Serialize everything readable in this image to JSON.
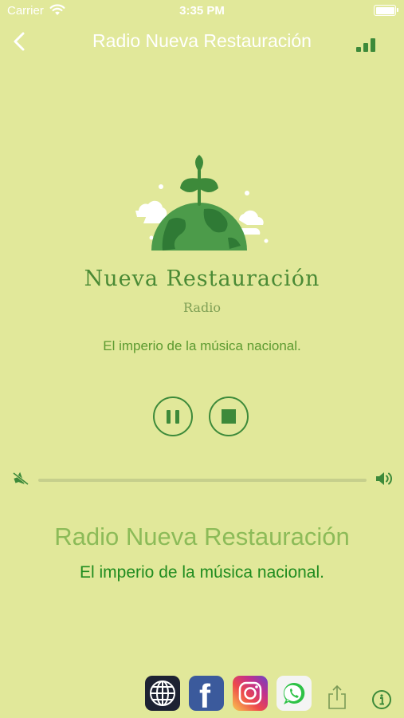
{
  "status_bar": {
    "carrier": "Carrier",
    "time": "3:35 PM"
  },
  "nav": {
    "title": "Radio Nueva Restauración"
  },
  "logo": {
    "name": "Nueva Restauración",
    "subtitle": "Radio"
  },
  "station": {
    "slogan": "El imperio de la música nacional."
  },
  "volume": {
    "level": 0.0
  },
  "now_playing": {
    "station": "Radio Nueva Restauración",
    "slogan": "El imperio de la música nacional."
  },
  "colors": {
    "background": "#e1e89a",
    "accent_green": "#3d8a3a",
    "slogan_green": "#1f8c1f",
    "station_green": "#8cbb58"
  },
  "icons": {
    "back": "chevron-left-icon",
    "signal": "signal-bars-icon",
    "pause": "pause-icon",
    "stop": "stop-icon",
    "mute": "speaker-mute-icon",
    "volume": "speaker-volume-icon",
    "web": "globe-icon",
    "facebook": "facebook-icon",
    "instagram": "instagram-icon",
    "whatsapp": "whatsapp-icon",
    "share": "share-icon",
    "info": "info-icon"
  }
}
